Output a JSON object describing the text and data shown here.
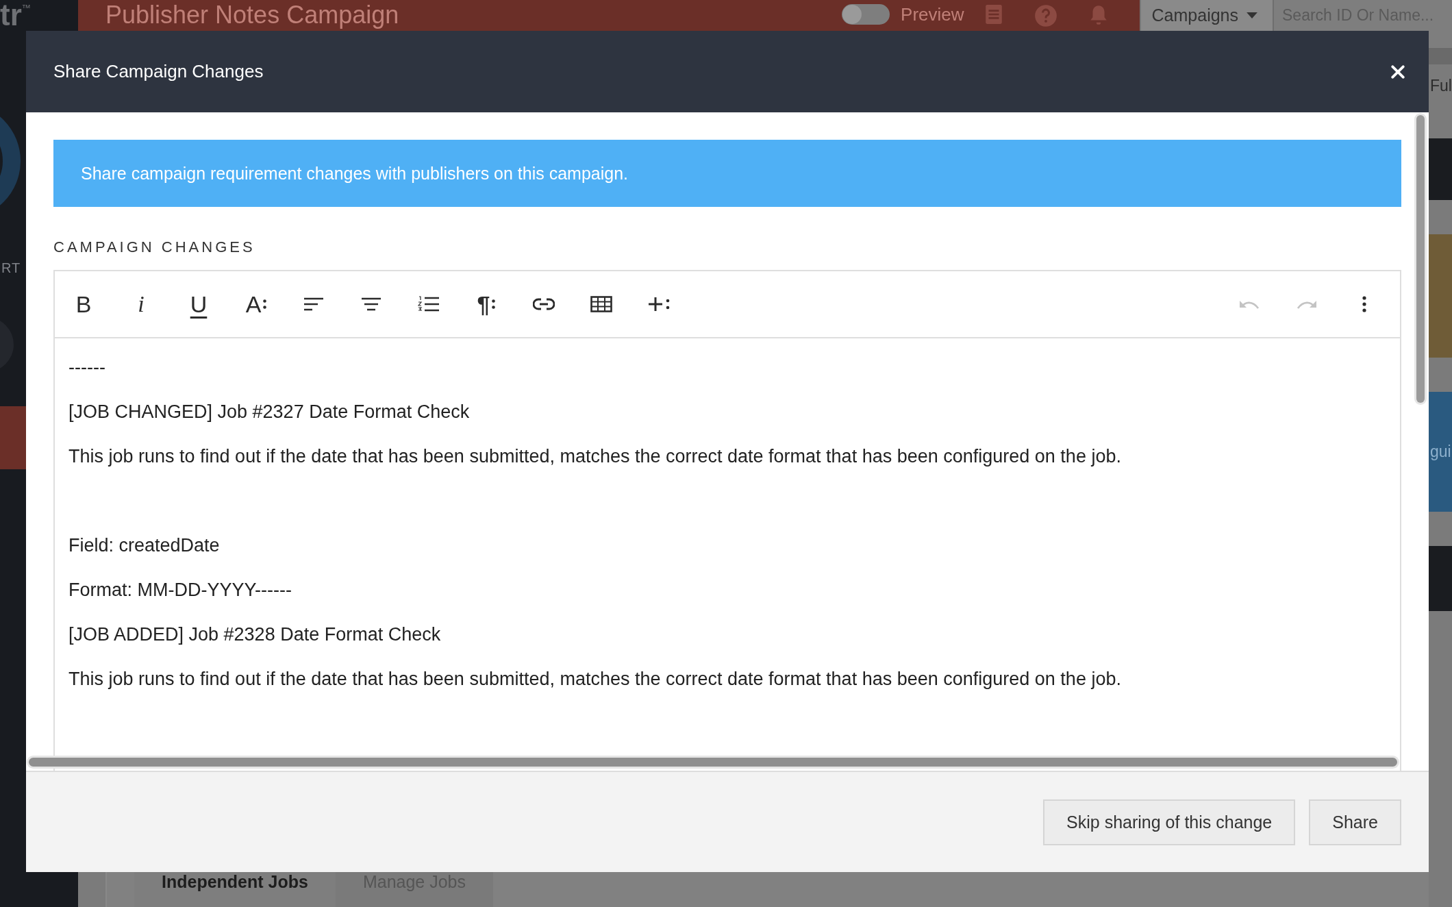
{
  "background": {
    "logo": "tr",
    "logo_mark": "™",
    "page_title": "Publisher Notes Campaign",
    "preview": {
      "label": "Preview",
      "on": false
    },
    "menu_label": "Campaigns",
    "search": {
      "placeholder": "Search ID Or Name..."
    },
    "sidebar_label": "RT",
    "right_heading": "Ful",
    "right_link": "gui",
    "tabs": [
      {
        "label": "Independent Jobs",
        "selected": true
      },
      {
        "label": "Manage Jobs",
        "selected": false
      }
    ]
  },
  "modal": {
    "title": "Share Campaign Changes",
    "banner": "Share campaign requirement changes with publishers on this campaign.",
    "section_label": "CAMPAIGN CHANGES",
    "toolbar": [
      {
        "kind": "bold",
        "label": "B",
        "disabled": false
      },
      {
        "kind": "italic",
        "label": "i",
        "disabled": false
      },
      {
        "kind": "underline",
        "label": "U",
        "disabled": false
      },
      {
        "kind": "font-size",
        "label": "A",
        "disabled": false
      },
      {
        "kind": "align-left",
        "disabled": false
      },
      {
        "kind": "align-center",
        "disabled": false
      },
      {
        "kind": "ordered-list",
        "disabled": false
      },
      {
        "kind": "paragraph",
        "label": "¶",
        "disabled": false
      },
      {
        "kind": "link",
        "disabled": false
      },
      {
        "kind": "table",
        "disabled": false
      },
      {
        "kind": "insert",
        "disabled": false
      },
      {
        "kind": "undo",
        "disabled": true
      },
      {
        "kind": "redo",
        "disabled": true
      },
      {
        "kind": "more",
        "disabled": false
      }
    ],
    "paragraphs": [
      {
        "kind": "text",
        "text": "------"
      },
      {
        "kind": "text",
        "text": "[JOB CHANGED] Job #2327 Date Format Check"
      },
      {
        "kind": "text",
        "text": "This job runs to find out if the date that has been submitted, matches the correct date format that has been configured on the job."
      },
      {
        "kind": "blank"
      },
      {
        "kind": "text",
        "text": "Field: createdDate"
      },
      {
        "kind": "text",
        "text": "Format: MM-DD-YYYY------"
      },
      {
        "kind": "text",
        "text": "[JOB ADDED] Job #2328 Date Format Check"
      },
      {
        "kind": "text",
        "text": "This job runs to find out if the date that has been submitted, matches the correct date format that has been configured on the job."
      },
      {
        "kind": "blank"
      }
    ],
    "buttons": [
      "Skip sharing of this change",
      "Share"
    ]
  }
}
